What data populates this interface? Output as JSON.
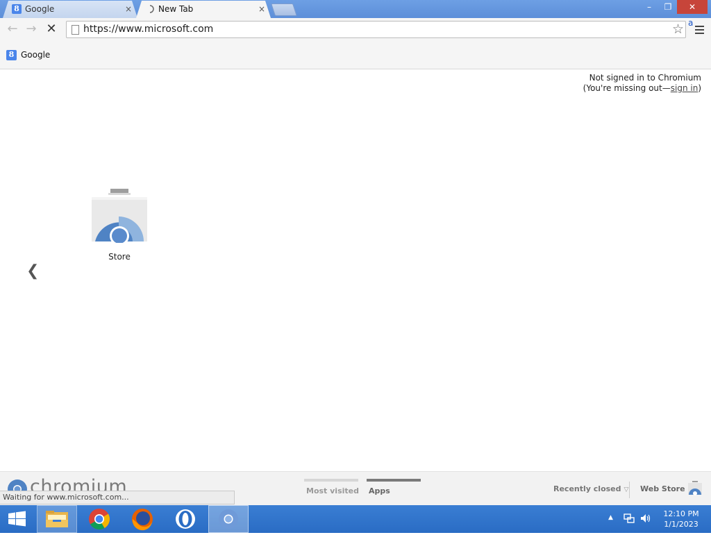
{
  "tabs": [
    {
      "title": "Google",
      "close": "×",
      "favicon": "google-favicon"
    },
    {
      "title": "New Tab",
      "close": "×",
      "favicon": "loading-spinner"
    }
  ],
  "window_controls": {
    "minimize": "–",
    "restore": "❐",
    "close": "✕"
  },
  "toolbar": {
    "back": "←",
    "forward": "→",
    "stop": "✕",
    "url": "https://www.microsoft.com",
    "bookmark_star": "☆",
    "extension_badge": "a"
  },
  "bookmarks": [
    {
      "label": "Google",
      "icon_letter": "8"
    }
  ],
  "signin": {
    "line1": "Not signed in to Chromium",
    "line2_prefix": "(You're missing out—",
    "link": "sign in",
    "line2_suffix": ")"
  },
  "apps": [
    {
      "label": "Store",
      "icon": "chrome-web-store-icon"
    }
  ],
  "ntp_nav": {
    "prev_arrow": "❮"
  },
  "footer": {
    "brand": "chromium",
    "most_visited": "Most visited",
    "apps": "Apps",
    "recently_closed": "Recently closed",
    "recently_closed_arrow": "▽",
    "web_store": "Web Store"
  },
  "status": "Waiting for www.microsoft.com...",
  "taskbar": {
    "items": [
      "start",
      "file-explorer",
      "chrome",
      "firefox",
      "opera",
      "chromium"
    ],
    "tray_arrow": "▲",
    "time": "12:10 PM",
    "date": "1/1/2023"
  },
  "colors": {
    "titlebar": "#6d9fe4",
    "taskbar": "#2a6cc4",
    "close_button": "#c7453a",
    "store_blue": "#4f83c4"
  }
}
